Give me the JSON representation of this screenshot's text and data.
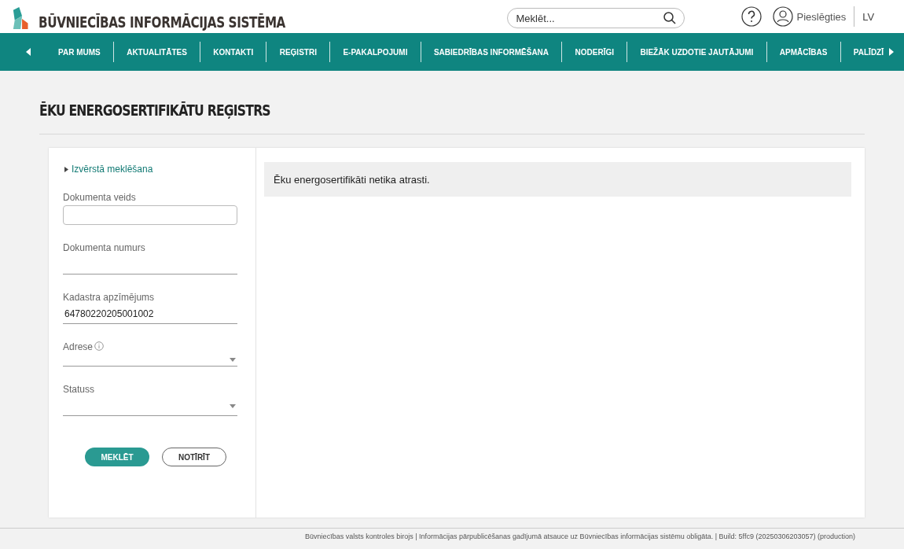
{
  "header": {
    "logo_text": "BŪVNIECĪBAS INFORMĀCIJAS SISTĒMA",
    "search": {
      "placeholder": "Meklēt..."
    },
    "login": "Pieslēgties",
    "language": "LV"
  },
  "nav": {
    "items": [
      {
        "label": "PAR MUMS"
      },
      {
        "label": "AKTUALITĀTES"
      },
      {
        "label": "KONTAKTI"
      },
      {
        "label": "REĢISTRI"
      },
      {
        "label": "E-PAKALPOJUMI"
      },
      {
        "label": "SABIEDRĪBAS INFORMĒŠANA"
      },
      {
        "label": "NODERĪGI"
      },
      {
        "label": "BIEŽĀK UZDOTIE JAUTĀJUMI"
      },
      {
        "label": "APMĀCĪBAS"
      },
      {
        "label": "PALĪDZĪ"
      }
    ]
  },
  "page_title": "ĒKU ENERGOSERTIFIKĀTU REĢISTRS",
  "filters": {
    "advanced_link": "Izvērstā meklēšana",
    "fields": [
      {
        "kind": "box",
        "label": "Dokumenta veids"
      },
      {
        "kind": "line",
        "label": "Dokumenta numurs"
      },
      {
        "kind": "line",
        "label": "Kadastra apzīmējums",
        "value": "64780220205001002"
      },
      {
        "kind": "select",
        "label": "Adrese",
        "info": true
      },
      {
        "kind": "select",
        "label": "Statuss"
      }
    ],
    "buttons": [
      {
        "kind": "primary",
        "label": "MEKLĒT"
      },
      {
        "kind": "secondary",
        "label": "NOTĪRĪT"
      }
    ]
  },
  "message": "Ēku energosertifikāti netika atrasti.",
  "footer": "Būvniecības valsts kontroles birojs | Informācijas pārpublicēšanas gadījumā atsauce uz Būvniecības informācijas sistēmu obligāta. | Build: 5ffc9 (20250306203057) (production)"
}
